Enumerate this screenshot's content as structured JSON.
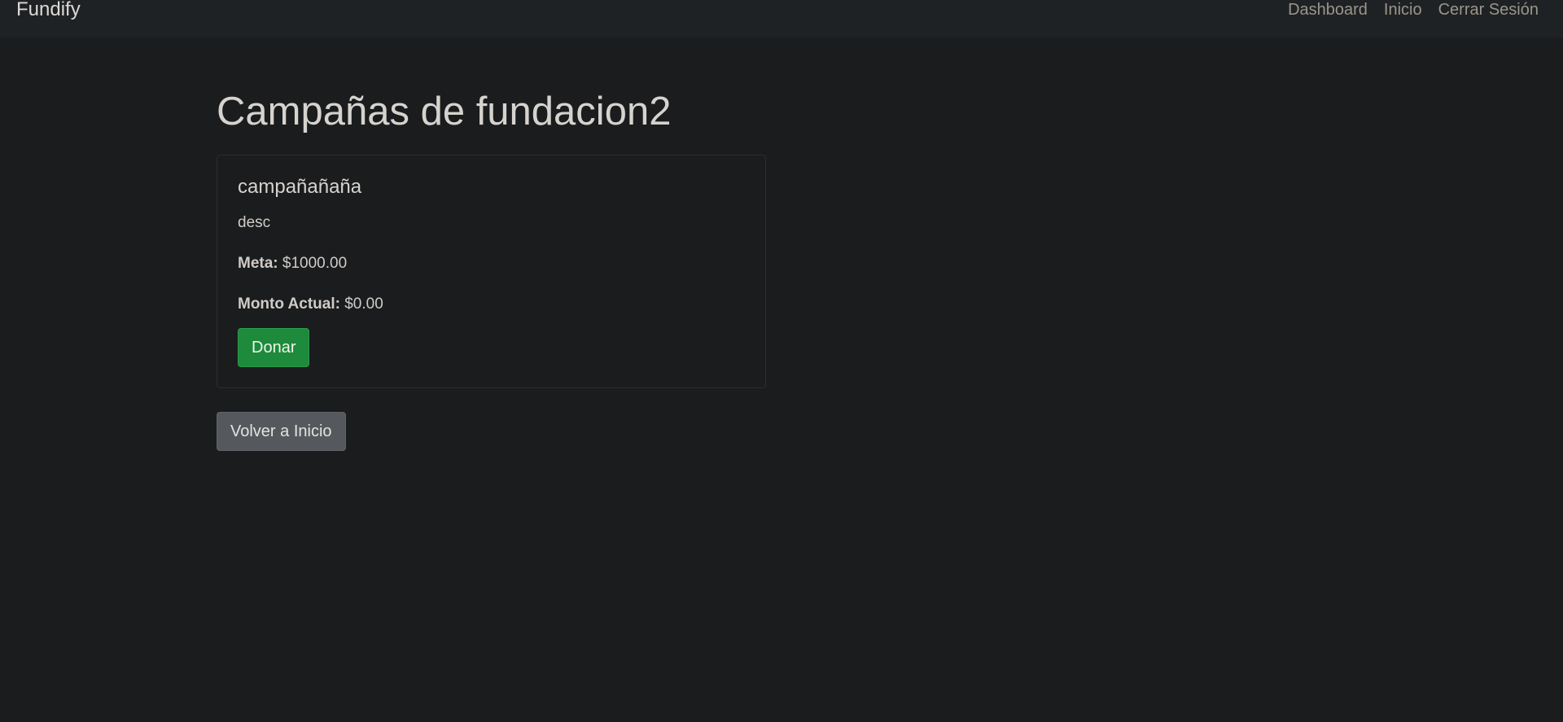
{
  "navbar": {
    "brand": "Fundify",
    "links": [
      "Dashboard",
      "Inicio",
      "Cerrar Sesión"
    ]
  },
  "main": {
    "title": "Campañas de fundacion2",
    "campaigns": [
      {
        "name": "campañañaña",
        "description": "desc",
        "goal_label": "Meta:",
        "goal_value": "$1000.00",
        "current_label": "Monto Actual:",
        "current_value": "$0.00",
        "donate_label": "Donar"
      }
    ],
    "back_label": "Volver a Inicio"
  },
  "colors": {
    "background": "#1b1c1e",
    "navbar": "#1f2224",
    "success": "#1e8a3b",
    "secondary": "#55595d"
  }
}
